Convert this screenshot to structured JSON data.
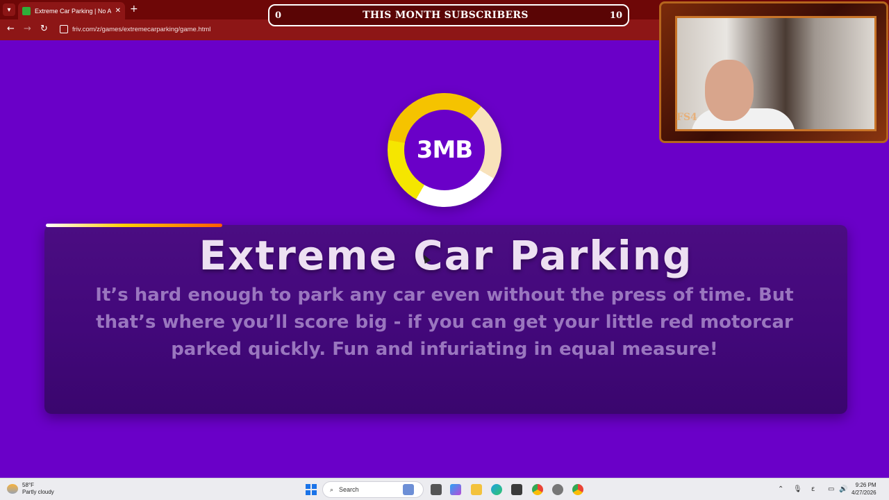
{
  "browser": {
    "tab_title": "Extreme Car Parking | No Ads |",
    "url": "friv.com/z/games/extremecarparking/game.html",
    "close_tab": "✕",
    "new_tab": "+"
  },
  "stream_overlay": {
    "subs_left": "0",
    "subs_label": "THIS MONTH SUBSCRIBERS",
    "subs_right": "10",
    "cam_logo": "FS4"
  },
  "game": {
    "logo_text": "3MB",
    "title": "Extreme Car Parking",
    "description": "It’s hard enough to park any car even without the press of time. But that’s where you’ll score big - if you can get your little red motorcar parked quickly. Fun and infuriating in equal measure!",
    "loading_progress": 0.22
  },
  "taskbar": {
    "temperature": "58°F",
    "condition": "Partly cloudy",
    "search_label": "Search",
    "time": "9:26 PM",
    "date": "4/27/2026"
  }
}
